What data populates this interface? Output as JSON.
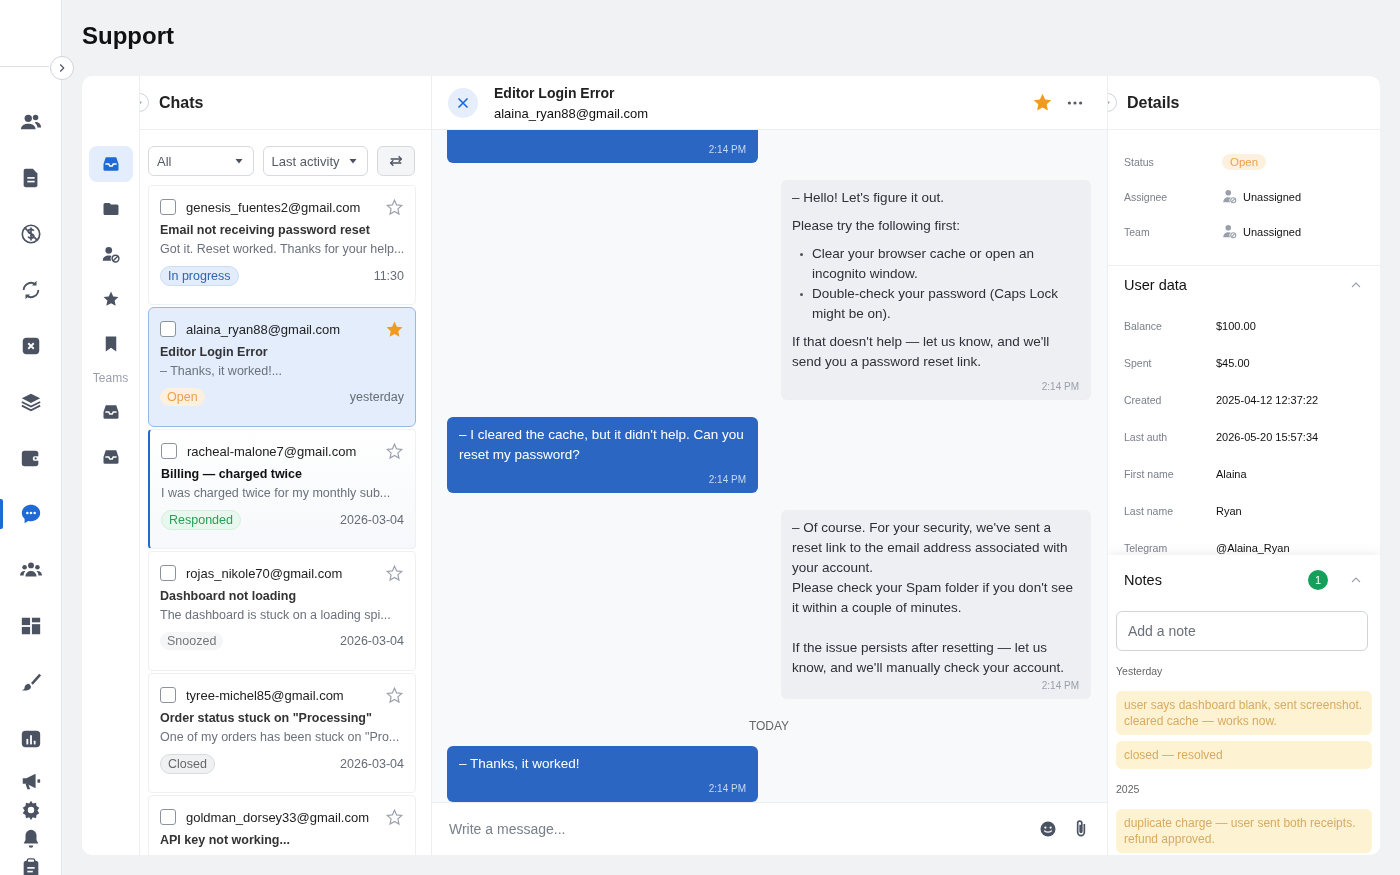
{
  "page_title": "Support",
  "nav_items": [
    {
      "selected": false
    },
    {
      "selected": false
    },
    {
      "selected": false
    },
    {
      "selected": false
    },
    {
      "selected": false
    },
    {
      "selected": false
    },
    {
      "selected": false
    },
    {
      "selected": true
    },
    {
      "selected": false
    },
    {
      "selected": false
    },
    {
      "selected": false
    },
    {
      "selected": false
    },
    {
      "selected": false
    },
    {
      "selected": false
    },
    {
      "selected": false
    },
    {
      "selected": false
    }
  ],
  "folders": [
    {
      "kind": "inbox",
      "selected": true
    },
    {
      "kind": "folder",
      "selected": false
    },
    {
      "kind": "unassigned",
      "selected": false
    },
    {
      "kind": "star",
      "selected": false
    },
    {
      "kind": "bookmark",
      "selected": false
    },
    {
      "kind": "label",
      "text": "Teams"
    },
    {
      "kind": "inbox",
      "selected": false
    },
    {
      "kind": "inbox",
      "selected": false
    }
  ],
  "chats": {
    "title": "Chats",
    "filters": [
      {
        "value": "All"
      },
      {
        "value": "Last activity"
      }
    ],
    "items": [
      {
        "email": "genesis_fuentes2@gmail.com",
        "subject": "Email not receiving password reset",
        "preview": "Got it. Reset worked. Thanks for your help...",
        "status": "In progress",
        "kind": "progress",
        "time": "11:30",
        "starred": false,
        "checked": false,
        "selected": false,
        "unread": false
      },
      {
        "email": "alaina_ryan88@gmail.com",
        "subject": "Editor Login Error",
        "preview": "– Thanks, it worked!...",
        "status": "Open",
        "kind": "open",
        "time": "yesterday",
        "starred": true,
        "checked": false,
        "selected": true,
        "unread": false
      },
      {
        "email": "racheal-malone7@gmail.com",
        "subject": "Billing — charged twice",
        "preview": "I was charged twice for my monthly sub...",
        "status": "Responded",
        "kind": "responded",
        "time": "2026-03-04",
        "starred": false,
        "checked": false,
        "selected": false,
        "unread": true
      },
      {
        "email": "rojas_nikole70@gmail.com",
        "subject": "Dashboard not loading",
        "preview": "The dashboard is stuck on a loading spi...",
        "status": "Snoozed",
        "kind": "snoozed",
        "time": "2026-03-04",
        "starred": false,
        "checked": false,
        "selected": false,
        "unread": false
      },
      {
        "email": "tyree-michel85@gmail.com",
        "subject": "Order status stuck on \"Processing\"",
        "preview": "One of my orders has been stuck on \"Pro...",
        "status": "Closed",
        "kind": "closed",
        "time": "2026-03-04",
        "starred": false,
        "checked": false,
        "selected": false,
        "unread": false
      },
      {
        "email": "goldman_dorsey33@gmail.com",
        "subject": "API key not working...",
        "starred": false,
        "checked": false,
        "selected": false,
        "unread": false
      }
    ]
  },
  "conversation": {
    "title": "Editor Login Error",
    "email": "alaina_ryan88@gmail.com",
    "starred": true,
    "messages": [
      {
        "kind": "customer",
        "cut": true,
        "time": "2:14 PM"
      },
      {
        "kind": "agent",
        "blocks": [
          {
            "kind": "text",
            "text": "– Hello! Let's figure it out."
          },
          {
            "kind": "text",
            "text": "Please try the following first:"
          },
          {
            "kind": "list",
            "items": [
              "Clear your browser cache or open an incognito window.",
              "Double-check your password (Caps Lock might be on)."
            ]
          },
          {
            "kind": "text",
            "text": "If that doesn't help — let us know, and we'll send you a password reset link."
          }
        ],
        "time": "2:14 PM"
      },
      {
        "kind": "customer",
        "blocks": [
          {
            "kind": "text",
            "text": "– I cleared the cache, but it didn't help. Can you reset my password?"
          }
        ],
        "time": "2:14 PM"
      },
      {
        "kind": "agent",
        "blocks": [
          {
            "kind": "plain",
            "text": "– Of course. For your security, we've sent a reset link to the email address associated with your account."
          },
          {
            "kind": "plain",
            "text": "Please check your Spam folder if you don't see it within a couple of minutes."
          },
          {
            "kind": "gap",
            "text": "If the issue persists after resetting — let us know, and we'll manually check your account."
          }
        ],
        "time": "2:14 PM"
      },
      {
        "kind": "divider",
        "text": "TODAY"
      },
      {
        "kind": "customer",
        "blocks": [
          {
            "kind": "text",
            "text": "– Thanks, it worked!"
          }
        ],
        "time": "2:14 PM"
      }
    ],
    "composer": {
      "placeholder": "Write a message..."
    }
  },
  "details": {
    "title": "Details",
    "status": {
      "label": "Status",
      "value": "Open"
    },
    "assignment": [
      {
        "label": "Assignee",
        "value": "Unassigned"
      },
      {
        "label": "Team",
        "value": "Unassigned"
      }
    ],
    "user_data": {
      "title": "User data",
      "expanded": true,
      "rows": [
        {
          "label": "Balance",
          "value": "$100.00"
        },
        {
          "label": "Spent",
          "value": "$45.00"
        },
        {
          "label": "Created",
          "value": "2025-04-12 12:37:22"
        },
        {
          "label": "Last auth",
          "value": "2026-05-20 15:57:34"
        },
        {
          "label": "First name",
          "value": "Alaina"
        },
        {
          "label": "Last name",
          "value": "Ryan"
        },
        {
          "label": "Telegram",
          "value": "@Alaina_Ryan"
        }
      ]
    },
    "notes": {
      "title": "Notes",
      "count": "1",
      "expanded": true,
      "placeholder": "Add a note",
      "groups": [
        {
          "label": "Yesterday",
          "items": [
            "user says dashboard blank, sent screenshot. cleared cache — works now.",
            "closed — resolved"
          ]
        },
        {
          "label": "2025",
          "items": [
            "duplicate charge — user sent both receipts. refund approved."
          ]
        }
      ]
    }
  }
}
